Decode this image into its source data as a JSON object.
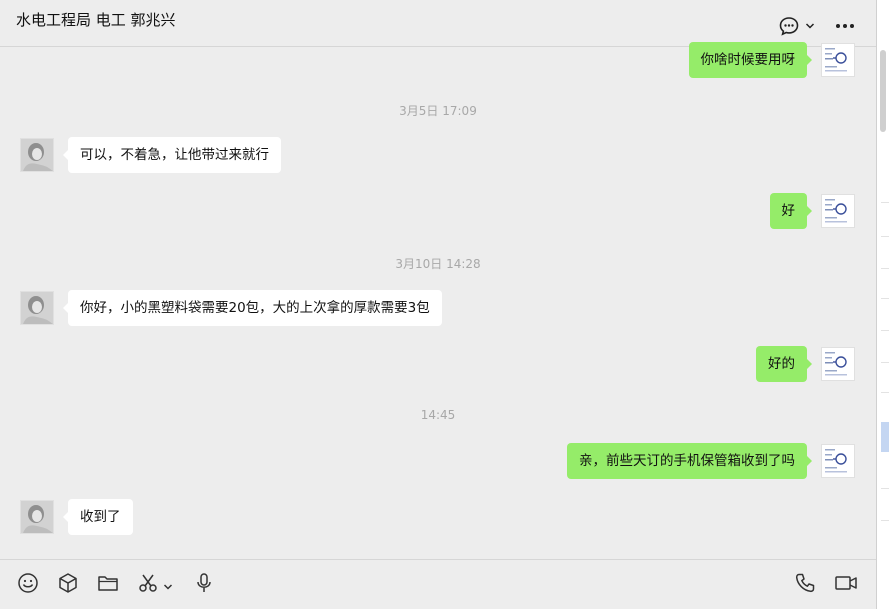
{
  "header": {
    "title": "水电工程局 电工 郭兆兴"
  },
  "messages": [
    {
      "kind": "text",
      "side": "out",
      "text": "你啥时候要用呀"
    },
    {
      "kind": "time",
      "text": "3月5日 17:09"
    },
    {
      "kind": "text",
      "side": "in",
      "text": "可以，不着急，让他带过来就行"
    },
    {
      "kind": "text",
      "side": "out",
      "text": "好"
    },
    {
      "kind": "time",
      "text": "3月10日 14:28"
    },
    {
      "kind": "text",
      "side": "in",
      "text": "你好，小的黑塑料袋需要20包，大的上次拿的厚款需要3包"
    },
    {
      "kind": "text",
      "side": "out",
      "text": "好的"
    },
    {
      "kind": "time",
      "text": "14:45"
    },
    {
      "kind": "text",
      "side": "out",
      "text": "亲，前些天订的手机保管箱收到了吗"
    },
    {
      "kind": "text",
      "side": "in",
      "text": "收到了"
    }
  ],
  "icons": {
    "chat_options": "speech-bubble-icon",
    "more": "more-dots-icon",
    "emoji": "emoji-icon",
    "favorites": "cube-icon",
    "file": "folder-icon",
    "screenshot": "scissors-icon",
    "voice": "microphone-icon",
    "call": "phone-icon",
    "video": "video-camera-icon"
  },
  "colors": {
    "background": "#ededed",
    "outgoing_bubble": "#95ec69",
    "incoming_bubble": "#ffffff",
    "timestamp": "#a8a8a8"
  }
}
